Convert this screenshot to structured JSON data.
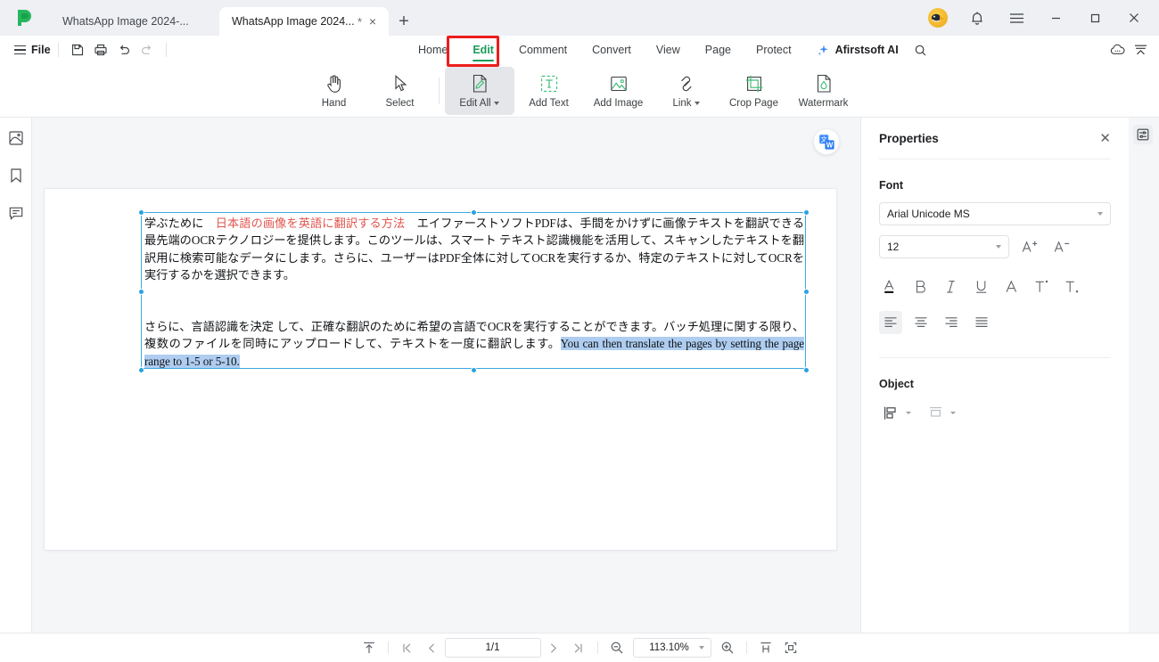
{
  "titlebar": {
    "tabs": [
      {
        "label": "WhatsApp Image 2024-...",
        "active": false,
        "dirty": ""
      },
      {
        "label": "WhatsApp Image 2024...",
        "active": true,
        "dirty": "*"
      }
    ],
    "new_tab_label": "+",
    "close_label": "×",
    "buttons": [
      "avatar",
      "notification-bell",
      "main-menu",
      "minimize",
      "maximize",
      "close"
    ]
  },
  "menubar": {
    "file_label": "File",
    "quick_actions": [
      "save-as-icon",
      "print-icon",
      "undo-icon",
      "redo-icon"
    ],
    "ribbon_tabs": [
      {
        "label": "Home",
        "active": false
      },
      {
        "label": "Edit",
        "active": true
      },
      {
        "label": "Comment",
        "active": false
      },
      {
        "label": "Convert",
        "active": false
      },
      {
        "label": "View",
        "active": false
      },
      {
        "label": "Page",
        "active": false
      },
      {
        "label": "Protect",
        "active": false
      }
    ],
    "ai_label": "Afirstsoft AI",
    "search_icon": "search-icon",
    "right_icons": [
      "cloud-icon",
      "collapse-ribbon-icon"
    ],
    "highlight_color": "#ee1c1c",
    "accent_color": "#1a9c5b"
  },
  "toolbar": {
    "tools": [
      {
        "label": "Hand",
        "icon": "hand-icon",
        "active": false,
        "dropdown": false
      },
      {
        "label": "Select",
        "icon": "cursor-icon",
        "active": false,
        "dropdown": false
      },
      {
        "label": "Edit All",
        "icon": "edit-all-icon",
        "active": true,
        "dropdown": true
      },
      {
        "label": "Add Text",
        "icon": "add-text-icon",
        "active": false,
        "dropdown": false
      },
      {
        "label": "Add Image",
        "icon": "add-image-icon",
        "active": false,
        "dropdown": false
      },
      {
        "label": "Link",
        "icon": "link-icon",
        "active": false,
        "dropdown": true
      },
      {
        "label": "Crop Page",
        "icon": "crop-page-icon",
        "active": false,
        "dropdown": false
      },
      {
        "label": "Watermark",
        "icon": "watermark-icon",
        "active": false,
        "dropdown": false
      }
    ]
  },
  "left_rail": {
    "items": [
      {
        "icon": "page-thumbnail-icon",
        "name": "thumbnails"
      },
      {
        "icon": "bookmark-icon",
        "name": "bookmarks"
      },
      {
        "icon": "comment-icon",
        "name": "comments"
      }
    ]
  },
  "document": {
    "translate_fab_icon": "translate-icon",
    "paragraph_1": {
      "lead": "学ぶために　",
      "red_phrase": "日本語の画像を英語に翻訳する方法",
      "rest": "　エイファーストソフトPDFは、手間をかけずに画像テキストを翻訳できる最先端のOCRテクノロジーを提供します。このツールは、スマート テキスト認識機能を活用して、スキャンしたテキストを翻訳用に検索可能なデータにします。さらに、ユーザーはPDF全体に対してOCRを実行するか、特定のテキストに対してOCRを実行するかを選択できます。"
    },
    "paragraph_2": {
      "jp": "さらに、言語認識を決定 して、正確な翻訳のために希望の言語でOCRを実行することができます。バッチ処理に関する限り、複数のファイルを同時にアップロードして、テキストを一度に翻訳します。",
      "highlighted_en": "You can then translate the pages by setting the page range to 1-5 or 5-10."
    },
    "selection_color": "#29a3e0",
    "highlight_color": "#aecdf0",
    "red_text_color": "#e0564f"
  },
  "properties": {
    "title": "Properties",
    "close_label": "✕",
    "font_section": "Font",
    "font_family": "Arial Unicode MS",
    "font_size": "12",
    "increase_label": "A⁺",
    "decrease_label": "A⁻",
    "format_icons": [
      {
        "name": "font-color-icon",
        "label": "A"
      },
      {
        "name": "bold-icon",
        "label": "B"
      },
      {
        "name": "italic-icon",
        "label": "I"
      },
      {
        "name": "underline-icon",
        "label": "U"
      },
      {
        "name": "strikethrough-icon",
        "label": "A"
      },
      {
        "name": "superscript-icon",
        "label": "T"
      },
      {
        "name": "subscript-icon",
        "label": "T"
      }
    ],
    "align_icons": [
      {
        "name": "align-left-icon",
        "selected": true
      },
      {
        "name": "align-center-icon",
        "selected": false
      },
      {
        "name": "align-right-icon",
        "selected": false
      },
      {
        "name": "align-justify-icon",
        "selected": false
      }
    ],
    "object_section": "Object",
    "object_icons": [
      "align-objects-icon",
      "distribute-objects-icon"
    ]
  },
  "statusbar": {
    "fit_top_icon": "scroll-to-top-icon",
    "first_page_icon": "first-page-icon",
    "prev_page_icon": "previous-page-icon",
    "page_value": "1/1",
    "next_page_icon": "next-page-icon",
    "last_page_icon": "last-page-icon",
    "zoom_out_icon": "zoom-out-icon",
    "zoom_value": "113.10%",
    "zoom_in_icon": "zoom-in-icon",
    "fit_width_icon": "fit-width-icon",
    "fit_page_icon": "fit-page-icon"
  }
}
